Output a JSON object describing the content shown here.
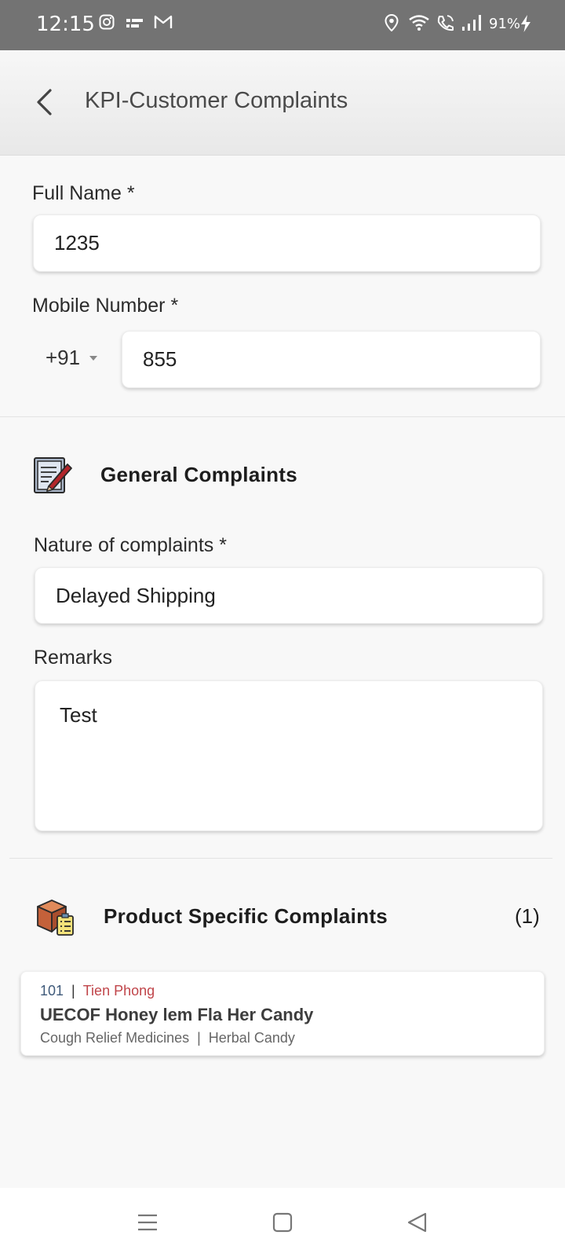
{
  "status_bar": {
    "time": "12:15",
    "battery": "91%",
    "left_icons": [
      "instagram-icon",
      "photo-lab-icon",
      "gmail-icon"
    ],
    "right_icons": [
      "location-icon",
      "wifi-icon",
      "wifi-calling-icon",
      "signal-icon",
      "charging-icon"
    ]
  },
  "header": {
    "title": "KPI-Customer Complaints",
    "back_icon": "chevron-left-icon"
  },
  "form": {
    "full_name_label": "Full Name *",
    "full_name_value": "1235",
    "mobile_label": "Mobile Number *",
    "country_code": "+91",
    "mobile_value": "855"
  },
  "general_complaints": {
    "title": "General Complaints",
    "icon": "notepad-pencil-icon",
    "nature_label": "Nature of complaints *",
    "nature_value": "Delayed Shipping",
    "remarks_label": "Remarks",
    "remarks_value": "Test"
  },
  "product_complaints": {
    "title": "Product Specific Complaints",
    "count": "(1)",
    "icon": "package-checklist-icon",
    "items": [
      {
        "code": "101",
        "separator": "|",
        "brand": "Tien Phong",
        "name": "UECOF Honey lem Fla Her Candy",
        "category": "Cough Relief Medicines",
        "subcategory": "Herbal Candy"
      }
    ]
  },
  "nav_bar": {
    "icons": [
      "menu-icon",
      "home-square-icon",
      "back-triangle-icon"
    ]
  },
  "colors": {
    "status_bar": "#737373",
    "header": "#eeeeee",
    "brand_text": "#c0454a",
    "code_text": "#3f5a7a"
  }
}
